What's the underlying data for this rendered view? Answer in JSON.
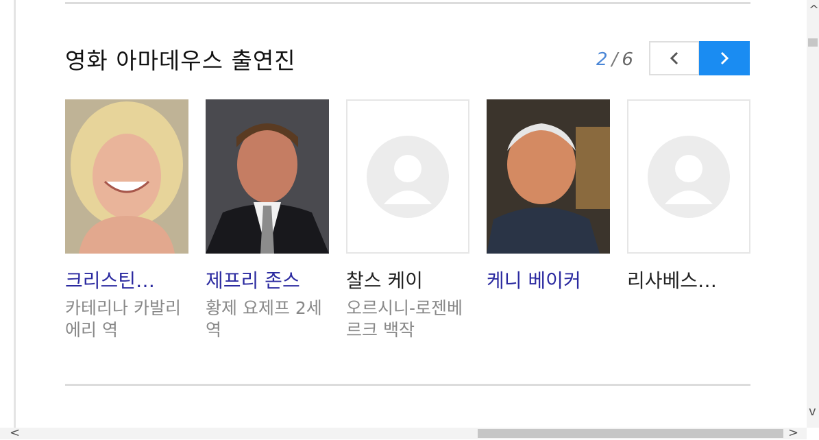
{
  "section": {
    "title": "영화 아마데우스 출연진",
    "pager": {
      "current": "2",
      "separator": "/",
      "total": "6"
    },
    "prev_icon": "chevron-left-icon",
    "next_icon": "chevron-right-icon",
    "accent_color": "#1a8cf2"
  },
  "cast": [
    {
      "name": "크리스틴…",
      "role": "카테리나 카발리에리 역",
      "link": true,
      "photo": "actress-photo"
    },
    {
      "name": "제프리 존스",
      "role": "황제 요제프 2세 역",
      "link": true,
      "photo": "actor-photo"
    },
    {
      "name": "찰스 케이",
      "role": "오르시니-로젠베르크 백작",
      "link": false,
      "photo": "placeholder-avatar-icon"
    },
    {
      "name": "케니 베이커",
      "role": "",
      "link": true,
      "photo": "actor-photo"
    },
    {
      "name": "리사베스…",
      "role": "",
      "link": false,
      "photo": "placeholder-avatar-icon"
    }
  ]
}
